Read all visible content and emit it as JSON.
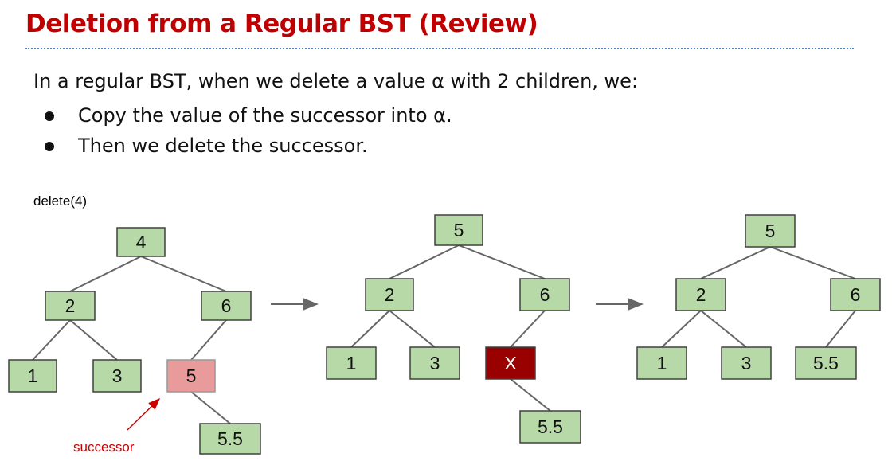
{
  "title": "Deletion from a Regular BST (Review)",
  "intro": "In a regular BST, when we delete a value α with 2 children, we:",
  "bullets": [
    "Copy the value of the successor into α.",
    "Then we delete the successor."
  ],
  "caption": "delete(4)",
  "successor_label": "successor",
  "colors": {
    "title": "#c00000",
    "node_fill": "#b7d9a8",
    "node_border": "#404040",
    "successor_fill": "#e99a9a",
    "deleted_fill": "#990000",
    "arrow": "#cc0000",
    "edge": "#666666"
  },
  "trees": [
    {
      "nodes": [
        {
          "id": "root",
          "label": "4",
          "state": "normal"
        },
        {
          "id": "l",
          "label": "2",
          "state": "normal"
        },
        {
          "id": "r",
          "label": "6",
          "state": "normal"
        },
        {
          "id": "ll",
          "label": "1",
          "state": "normal"
        },
        {
          "id": "lr",
          "label": "3",
          "state": "normal"
        },
        {
          "id": "rl",
          "label": "5",
          "state": "successor"
        },
        {
          "id": "rlr",
          "label": "5.5",
          "state": "normal"
        }
      ],
      "edges": [
        [
          "root",
          "l"
        ],
        [
          "root",
          "r"
        ],
        [
          "l",
          "ll"
        ],
        [
          "l",
          "lr"
        ],
        [
          "r",
          "rl"
        ],
        [
          "rl",
          "rlr"
        ]
      ]
    },
    {
      "nodes": [
        {
          "id": "root",
          "label": "5",
          "state": "normal"
        },
        {
          "id": "l",
          "label": "2",
          "state": "normal"
        },
        {
          "id": "r",
          "label": "6",
          "state": "normal"
        },
        {
          "id": "ll",
          "label": "1",
          "state": "normal"
        },
        {
          "id": "lr",
          "label": "3",
          "state": "normal"
        },
        {
          "id": "rl",
          "label": "X",
          "state": "deleted"
        },
        {
          "id": "rlr",
          "label": "5.5",
          "state": "normal"
        }
      ],
      "edges": [
        [
          "root",
          "l"
        ],
        [
          "root",
          "r"
        ],
        [
          "l",
          "ll"
        ],
        [
          "l",
          "lr"
        ],
        [
          "r",
          "rl"
        ],
        [
          "rl",
          "rlr"
        ]
      ]
    },
    {
      "nodes": [
        {
          "id": "root",
          "label": "5",
          "state": "normal"
        },
        {
          "id": "l",
          "label": "2",
          "state": "normal"
        },
        {
          "id": "r",
          "label": "6",
          "state": "normal"
        },
        {
          "id": "ll",
          "label": "1",
          "state": "normal"
        },
        {
          "id": "lr",
          "label": "3",
          "state": "normal"
        },
        {
          "id": "rl",
          "label": "5.5",
          "state": "normal"
        }
      ],
      "edges": [
        [
          "root",
          "l"
        ],
        [
          "root",
          "r"
        ],
        [
          "l",
          "ll"
        ],
        [
          "l",
          "lr"
        ],
        [
          "r",
          "rl"
        ]
      ]
    }
  ]
}
